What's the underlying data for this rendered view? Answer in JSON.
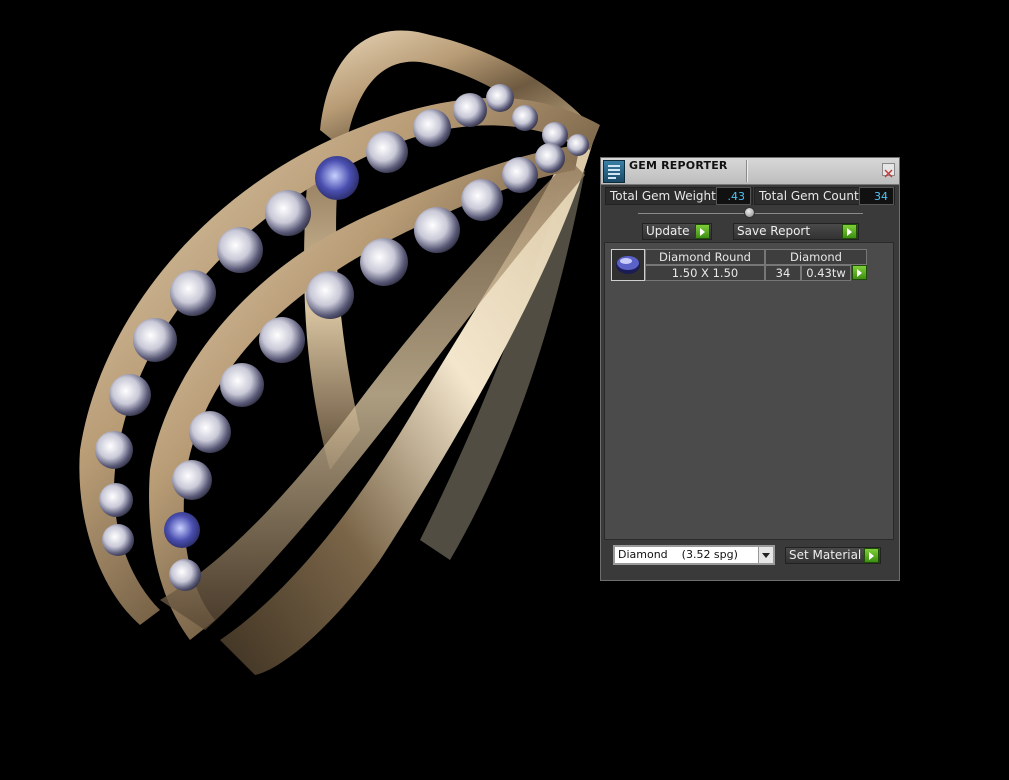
{
  "panel": {
    "title": "GEM REPORTER",
    "total_gem_weight_label": "Total Gem Weight",
    "total_gem_weight_value": ".43",
    "total_gem_count_label": "Total Gem Count",
    "total_gem_count_value": "34",
    "update_label": "Update",
    "save_report_label": "Save Report",
    "gem_row": {
      "shape": "Diamond Round",
      "material": "Diamond",
      "size": "1.50 X 1.50",
      "count": "34",
      "weight": "0.43tw"
    },
    "material_select_value": "Diamond    (3.52 spg)",
    "set_material_label": "Set Material"
  },
  "icons": {
    "title": "gem-reporter-icon",
    "close": "close-icon",
    "go": "play-arrow-icon",
    "thumb": "round-gem-icon",
    "dropdown": "chevron-down-icon"
  },
  "colors": {
    "metal": "#c7b08e",
    "value_text": "#4fc3f7",
    "go_button": "#5db32a"
  }
}
